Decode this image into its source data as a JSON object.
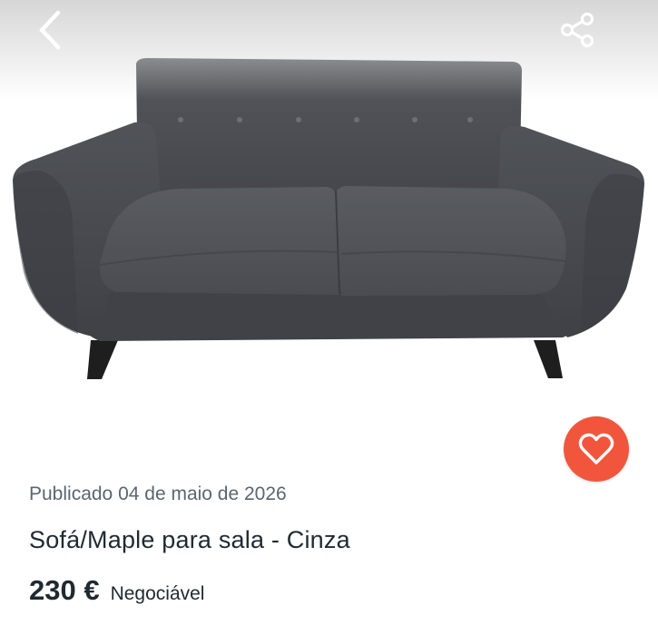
{
  "listing": {
    "published": "Publicado 04 de maio de 2026",
    "title": "Sofá/Maple para sala - Cinza",
    "price": "230 €",
    "negotiable": "Negociável"
  },
  "icons": {
    "back": "chevron-left-icon",
    "share": "share-icon",
    "favorite": "heart-icon"
  },
  "colors": {
    "accent": "#f1563d",
    "text": "#1f2a30",
    "muted": "#5a6670",
    "sofa": "#4b4d52"
  }
}
